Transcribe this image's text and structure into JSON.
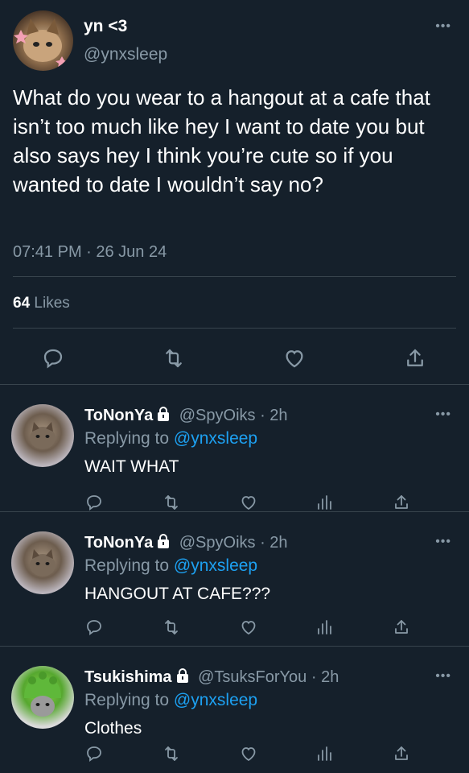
{
  "main_tweet": {
    "display_name": "yn <3",
    "handle": "@ynxsleep",
    "text": "What do you wear to a hangout at a cafe that isn’t too much like hey I want to date you but also says hey I think you’re cute so if you wanted to date I wouldn’t say no?",
    "timestamp": "07:41 PM · 26 Jun 24",
    "likes_count": "64",
    "likes_label": "Likes",
    "more": "•••"
  },
  "replies": [
    {
      "display_name": "ToNonYa",
      "handle": "@SpyOiks",
      "time": "· 2h",
      "replying_label": "Replying to",
      "replying_to": "@ynxsleep",
      "text": "WAIT WHAT",
      "more": "•••"
    },
    {
      "display_name": "ToNonYa",
      "handle": "@SpyOiks",
      "time": "· 2h",
      "replying_label": "Replying to",
      "replying_to": "@ynxsleep",
      "text": "HANGOUT AT CAFE???",
      "more": "•••"
    },
    {
      "display_name": "Tsukishima",
      "handle": "@TsuksForYou",
      "time": "· 2h",
      "replying_label": "Replying to",
      "replying_to": "@ynxsleep",
      "text": "Clothes",
      "more": "•••"
    }
  ],
  "icons": {
    "reply": "reply-icon",
    "retweet": "retweet-icon",
    "like": "heart-icon",
    "views": "views-icon",
    "share": "share-icon",
    "lock": "lock-icon"
  },
  "colors": {
    "background": "#15202b",
    "text_secondary": "#8899a6",
    "mention": "#1da1f2",
    "border": "#38444d"
  }
}
